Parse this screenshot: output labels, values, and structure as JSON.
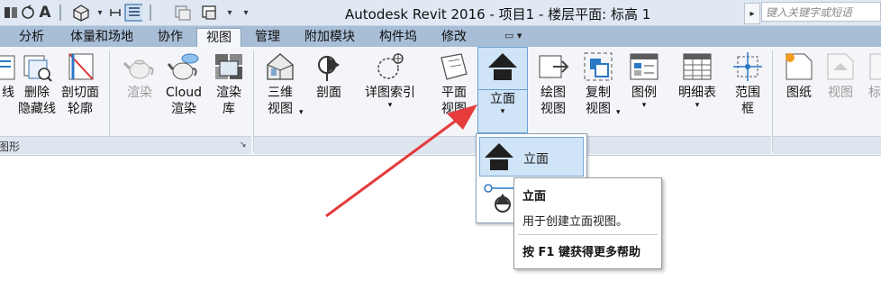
{
  "app": {
    "title": "Autodesk Revit 2016 -    项目1 - 楼层平面: 标高 1",
    "search_placeholder": "键入关键字或短语",
    "quick_access": {
      "sync_icon": "sync-icon",
      "text_glyph": "A",
      "separator_glyph": "▾",
      "expand_glyph": "▸"
    }
  },
  "tabs": [
    "分析",
    "体量和场地",
    "协作",
    "视图",
    "管理",
    "附加模块",
    "构件坞",
    "修改"
  ],
  "active_tab": "视图",
  "tab_extra_glyph": "▭ ▾",
  "ribbon": {
    "graphics_panel": {
      "title": "图形",
      "launcher_glyph": "↘",
      "buttons": [
        {
          "line1": "",
          "line2": "线"
        },
        {
          "line1": "删除",
          "line2": "隐藏线"
        },
        {
          "line1": "剖切面",
          "line2": "轮廓"
        }
      ]
    },
    "present_panel": {
      "buttons": [
        {
          "line1": "渲染",
          "line2": ""
        },
        {
          "line1": "Cloud",
          "line2": "渲染"
        },
        {
          "line1": "渲染",
          "line2": "库"
        }
      ]
    },
    "create_panel": {
      "buttons": [
        {
          "line1": "三维",
          "line2": "视图",
          "dropdown": "▾"
        },
        {
          "line1": "剖面",
          "line2": ""
        },
        {
          "line1": "详图索引",
          "line2": "",
          "dropdown": "▾"
        },
        {
          "line1": "平面",
          "line2": "视图"
        },
        {
          "line1": "立面",
          "line2": "",
          "dropdown": "▾"
        },
        {
          "line1": "绘图",
          "line2": "视图"
        },
        {
          "line1": "复制",
          "line2": "视图",
          "dropdown": "▾"
        },
        {
          "line1": "图例",
          "line2": "",
          "dropdown": "▾"
        },
        {
          "line1": "明细表",
          "line2": "",
          "dropdown": "▾"
        },
        {
          "line1": "范围",
          "line2": "框"
        }
      ]
    },
    "sheet_panel": {
      "buttons": [
        {
          "line1": "图纸",
          "line2": ""
        },
        {
          "line1": "视图",
          "line2": ""
        },
        {
          "line1": "标",
          "line2": ""
        }
      ]
    }
  },
  "elevation_dropdown": {
    "items": [
      {
        "label": "立面"
      }
    ]
  },
  "tooltip": {
    "title": "立面",
    "description": "用于创建立面视图。",
    "help": "按 F1 键获得更多帮助"
  },
  "colors": {
    "annotation_arrow": "#e53b3b",
    "highlight": "#cfe4f7",
    "tab_bar": "#a8bdd6"
  }
}
